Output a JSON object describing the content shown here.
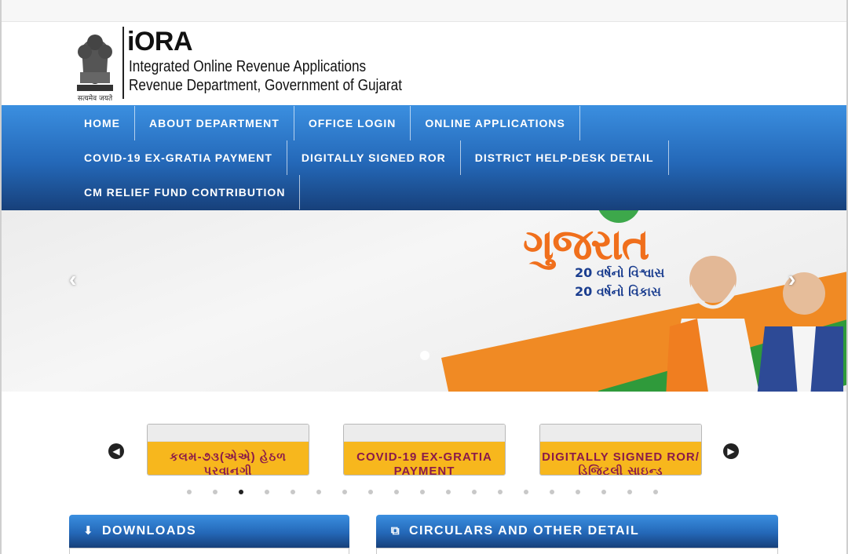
{
  "header": {
    "emblem_caption": "सत्यमेव जयते",
    "brand_title": "iORA",
    "brand_line1": "Integrated Online Revenue Applications",
    "brand_line2": "Revenue Department, Government of Gujarat"
  },
  "nav": {
    "row1": [
      "HOME",
      "ABOUT DEPARTMENT",
      "OFFICE LOGIN",
      "ONLINE APPLICATIONS"
    ],
    "row2": [
      "COVID-19 EX-GRATIA PAYMENT",
      "DIGITALLY SIGNED ROR",
      "DISTRICT HELP-DESK DETAIL"
    ],
    "row3": [
      "CM RELIEF FUND CONTRIBUTION"
    ]
  },
  "banner": {
    "headline": "ગુજરાત",
    "sub1": "20 વર્ષનો વિશ્વાસ",
    "sub2": "20 વર્ષનો વિકાસ",
    "prev_icon": "chevron-left-icon",
    "next_icon": "chevron-right-icon"
  },
  "services": {
    "cards": [
      {
        "label": "કલમ-૭૩(એએ) હેઠળ પરવાનગી"
      },
      {
        "label": "COVID-19 EX-GRATIA PAYMENT"
      },
      {
        "label": "DIGITALLY SIGNED ROR/ ડિજિટલી સાઇન્ડ"
      }
    ],
    "dot_count": 19,
    "active_dot": 3
  },
  "panels": {
    "downloads": "DOWNLOADS",
    "circulars": "CIRCULARS AND OTHER DETAIL"
  },
  "colors": {
    "nav_blue": "#2468b8",
    "card_yellow": "#f7b71d",
    "card_text": "#8a1a4a",
    "banner_orange": "#f06f1c"
  }
}
